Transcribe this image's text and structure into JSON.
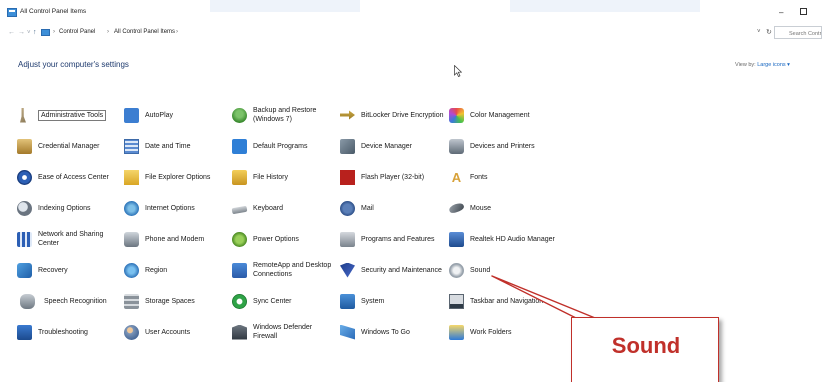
{
  "window": {
    "title": "All Control Panel Items",
    "minimize_glyph": "–"
  },
  "address": {
    "back_glyph": "←",
    "forward_glyph": "→",
    "recent_glyph": "˅",
    "up_glyph": "↑",
    "crumbs": [
      "Control Panel",
      "All Control Panel Items"
    ],
    "separator": "›",
    "dropdown_glyph": "˅",
    "refresh_glyph": "↻",
    "search_placeholder": "Search Control Panel"
  },
  "header": {
    "title": "Adjust your computer's settings",
    "view_by_label": "View by:",
    "view_by_value": "Large icons ▾"
  },
  "items": [
    {
      "label": "Administrative Tools",
      "icon": "administrative-tools-icon",
      "selected": true
    },
    {
      "label": "AutoPlay",
      "icon": "autoplay-icon"
    },
    {
      "label": "Backup and Restore (Windows 7)",
      "icon": "backup-restore-icon"
    },
    {
      "label": "BitLocker Drive Encryption",
      "icon": "bitlocker-icon"
    },
    {
      "label": "Color Management",
      "icon": "color-management-icon"
    },
    {
      "label": "Credential Manager",
      "icon": "credential-manager-icon"
    },
    {
      "label": "Date and Time",
      "icon": "date-time-icon"
    },
    {
      "label": "Default Programs",
      "icon": "default-programs-icon"
    },
    {
      "label": "Device Manager",
      "icon": "device-manager-icon"
    },
    {
      "label": "Devices and Printers",
      "icon": "devices-printers-icon"
    },
    {
      "label": "Ease of Access Center",
      "icon": "ease-of-access-icon"
    },
    {
      "label": "File Explorer Options",
      "icon": "file-explorer-options-icon"
    },
    {
      "label": "File History",
      "icon": "file-history-icon"
    },
    {
      "label": "Flash Player (32-bit)",
      "icon": "flash-player-icon"
    },
    {
      "label": "Fonts",
      "icon": "fonts-icon"
    },
    {
      "label": "Indexing Options",
      "icon": "indexing-options-icon"
    },
    {
      "label": "Internet Options",
      "icon": "internet-options-icon"
    },
    {
      "label": "Keyboard",
      "icon": "keyboard-icon"
    },
    {
      "label": "Mail",
      "icon": "mail-icon"
    },
    {
      "label": "Mouse",
      "icon": "mouse-icon"
    },
    {
      "label": "Network and Sharing Center",
      "icon": "network-sharing-icon"
    },
    {
      "label": "Phone and Modem",
      "icon": "phone-modem-icon"
    },
    {
      "label": "Power Options",
      "icon": "power-options-icon"
    },
    {
      "label": "Programs and Features",
      "icon": "programs-features-icon"
    },
    {
      "label": "Realtek HD Audio Manager",
      "icon": "realtek-audio-icon"
    },
    {
      "label": "Recovery",
      "icon": "recovery-icon"
    },
    {
      "label": "Region",
      "icon": "region-icon"
    },
    {
      "label": "RemoteApp and Desktop Connections",
      "icon": "remoteapp-icon"
    },
    {
      "label": "Security and Maintenance",
      "icon": "security-maintenance-icon"
    },
    {
      "label": "Sound",
      "icon": "sound-icon"
    },
    {
      "label": "Speech Recognition",
      "icon": "speech-recognition-icon"
    },
    {
      "label": "Storage Spaces",
      "icon": "storage-spaces-icon"
    },
    {
      "label": "Sync Center",
      "icon": "sync-center-icon"
    },
    {
      "label": "System",
      "icon": "system-icon"
    },
    {
      "label": "Taskbar and Navigation",
      "icon": "taskbar-navigation-icon"
    },
    {
      "label": "Troubleshooting",
      "icon": "troubleshooting-icon"
    },
    {
      "label": "User Accounts",
      "icon": "user-accounts-icon"
    },
    {
      "label": "Windows Defender Firewall",
      "icon": "windows-defender-firewall-icon"
    },
    {
      "label": "Windows To Go",
      "icon": "windows-to-go-icon"
    },
    {
      "label": "Work Folders",
      "icon": "work-folders-icon"
    }
  ],
  "callout": {
    "text": "Sound",
    "color": "#c0302a"
  }
}
